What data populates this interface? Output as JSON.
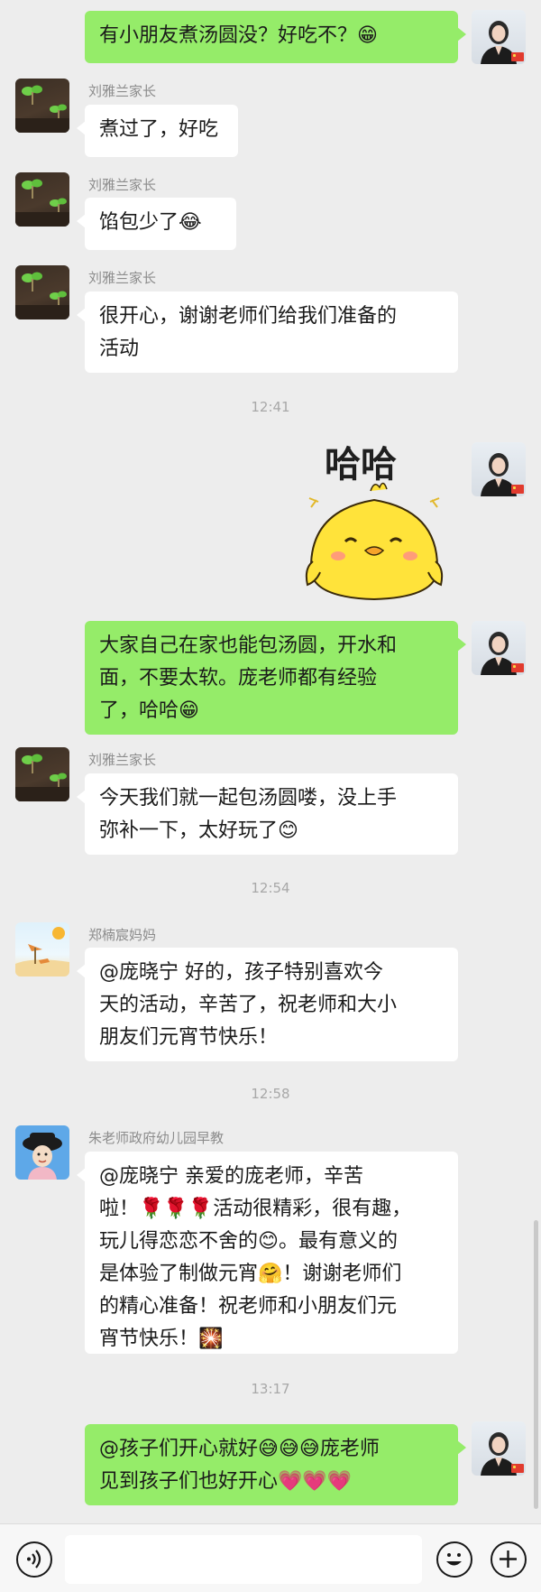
{
  "messages": {
    "m1": {
      "text": "有小朋友煮汤圆没？好吃不？",
      "emoji": "😁"
    },
    "m2": {
      "sender": "刘雅兰家长",
      "text": "煮过了，好吃"
    },
    "m3": {
      "sender": "刘雅兰家长",
      "text": "馅包少了",
      "emoji": "😂"
    },
    "m4": {
      "sender": "刘雅兰家长",
      "line1": "很开心，谢谢老师们给我们准备的",
      "line2": "活动"
    },
    "t1": "12:41",
    "sticker": {
      "text": "哈哈"
    },
    "m5": {
      "line1": "大家自己在家也能包汤圆，开水和",
      "line2": "面，不要太软。庞老师都有经验",
      "line3": "了，哈哈",
      "emoji": "😁"
    },
    "m6": {
      "sender": "刘雅兰家长",
      "line1": "今天我们就一起包汤圆喽，没上手",
      "line2": "弥补一下，太好玩了",
      "emoji": "😊"
    },
    "t2": "12:54",
    "m7": {
      "sender": "郑楠宸妈妈",
      "line1": "@庞晓宁  好的，孩子特别喜欢今",
      "line2": "天的活动，辛苦了，祝老师和大小",
      "line3": "朋友们元宵节快乐！"
    },
    "t3": "12:58",
    "m8": {
      "sender": "朱老师政府幼儿园早教",
      "line1": "@庞晓宁  亲爱的庞老师，辛苦",
      "line2a": "啦！",
      "roses": "🌹🌹🌹",
      "line2b": "活动很精彩，很有趣，",
      "line3a": "玩儿得恋恋不舍的",
      "smile": "😊",
      "line3b": "。最有意义的",
      "line4a": "是体验了制做元宵",
      "hug": "🤗",
      "line4b": "！谢谢老师们",
      "line5": "的精心准备！祝老师和小朋友们元",
      "line6a": "宵节快乐！",
      "fireworks": "🎇"
    },
    "t4": "13:17",
    "m9": {
      "line1a": "@孩子们开心就好",
      "emojis1": "😅😅😅",
      "line1b": "庞老师",
      "line2a": "见到孩子们也好开心",
      "hearts": "💗💗💗"
    }
  },
  "input": {
    "placeholder": ""
  },
  "icons": {
    "voice": "voice-icon",
    "emoji": "emoji-icon",
    "plus": "plus-icon"
  },
  "colors": {
    "background": "#ededed",
    "bubble_self": "#95ec69",
    "bubble_other": "#ffffff"
  }
}
